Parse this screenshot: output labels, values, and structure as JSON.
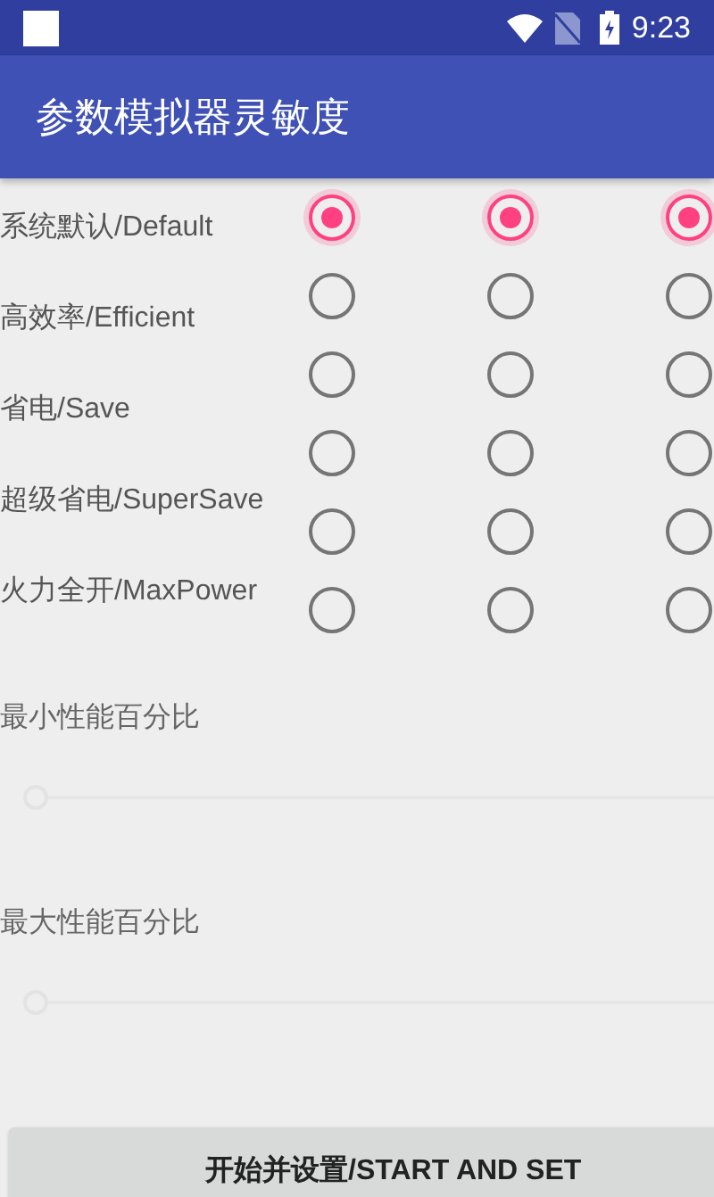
{
  "status_bar": {
    "time": "9:23"
  },
  "app_bar": {
    "title": "参数模拟器灵敏度"
  },
  "modes": [
    {
      "label": "系统默认/Default"
    },
    {
      "label": "高效率/Efficient"
    },
    {
      "label": "省电/Save"
    },
    {
      "label": "超级省电/SuperSave"
    },
    {
      "label": "火力全开/MaxPower"
    }
  ],
  "radio_groups": [
    {
      "options": [
        {
          "selected": true
        },
        {
          "selected": false
        },
        {
          "selected": false
        },
        {
          "selected": false
        },
        {
          "selected": false
        },
        {
          "selected": false
        }
      ]
    },
    {
      "options": [
        {
          "selected": true
        },
        {
          "selected": false
        },
        {
          "selected": false
        },
        {
          "selected": false
        },
        {
          "selected": false
        },
        {
          "selected": false
        }
      ]
    },
    {
      "options": [
        {
          "selected": true
        },
        {
          "selected": false
        },
        {
          "selected": false
        },
        {
          "selected": false
        },
        {
          "selected": false
        },
        {
          "selected": false
        }
      ]
    }
  ],
  "sliders": [
    {
      "label": "最小性能百分比",
      "level": 0
    },
    {
      "label": "最大性能百分比",
      "level": 0
    }
  ],
  "button": {
    "label": "开始并设置/START AND SET"
  }
}
